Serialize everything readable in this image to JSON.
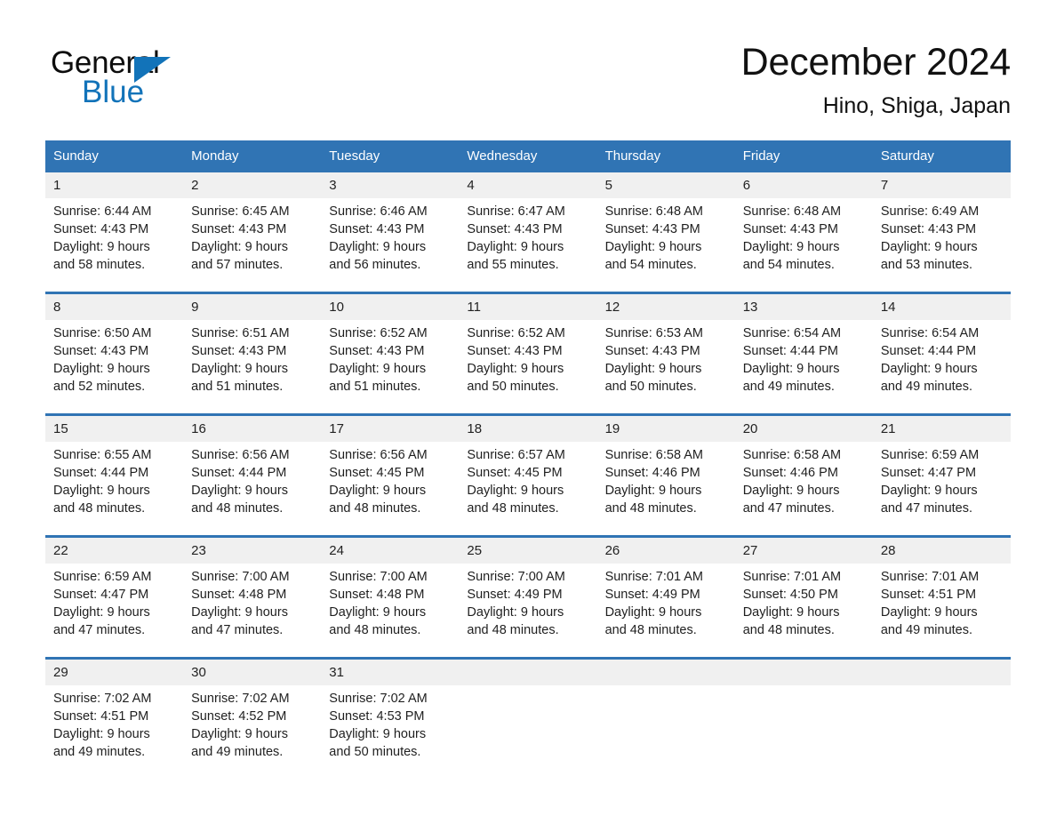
{
  "brand": {
    "name_part1": "General",
    "name_part2": "Blue",
    "triangle_color": "#1273b9"
  },
  "header": {
    "title": "December 2024",
    "location": "Hino, Shiga, Japan"
  },
  "colors": {
    "header_blue": "#3074b4",
    "row_band_gray": "#f0f0f0",
    "brand_blue": "#1273b9"
  },
  "calendar": {
    "weekday_headers": [
      "Sunday",
      "Monday",
      "Tuesday",
      "Wednesday",
      "Thursday",
      "Friday",
      "Saturday"
    ],
    "weeks": [
      [
        {
          "day": "1",
          "sunrise": "Sunrise: 6:44 AM",
          "sunset": "Sunset: 4:43 PM",
          "daylight_line1": "Daylight: 9 hours",
          "daylight_line2": "and 58 minutes."
        },
        {
          "day": "2",
          "sunrise": "Sunrise: 6:45 AM",
          "sunset": "Sunset: 4:43 PM",
          "daylight_line1": "Daylight: 9 hours",
          "daylight_line2": "and 57 minutes."
        },
        {
          "day": "3",
          "sunrise": "Sunrise: 6:46 AM",
          "sunset": "Sunset: 4:43 PM",
          "daylight_line1": "Daylight: 9 hours",
          "daylight_line2": "and 56 minutes."
        },
        {
          "day": "4",
          "sunrise": "Sunrise: 6:47 AM",
          "sunset": "Sunset: 4:43 PM",
          "daylight_line1": "Daylight: 9 hours",
          "daylight_line2": "and 55 minutes."
        },
        {
          "day": "5",
          "sunrise": "Sunrise: 6:48 AM",
          "sunset": "Sunset: 4:43 PM",
          "daylight_line1": "Daylight: 9 hours",
          "daylight_line2": "and 54 minutes."
        },
        {
          "day": "6",
          "sunrise": "Sunrise: 6:48 AM",
          "sunset": "Sunset: 4:43 PM",
          "daylight_line1": "Daylight: 9 hours",
          "daylight_line2": "and 54 minutes."
        },
        {
          "day": "7",
          "sunrise": "Sunrise: 6:49 AM",
          "sunset": "Sunset: 4:43 PM",
          "daylight_line1": "Daylight: 9 hours",
          "daylight_line2": "and 53 minutes."
        }
      ],
      [
        {
          "day": "8",
          "sunrise": "Sunrise: 6:50 AM",
          "sunset": "Sunset: 4:43 PM",
          "daylight_line1": "Daylight: 9 hours",
          "daylight_line2": "and 52 minutes."
        },
        {
          "day": "9",
          "sunrise": "Sunrise: 6:51 AM",
          "sunset": "Sunset: 4:43 PM",
          "daylight_line1": "Daylight: 9 hours",
          "daylight_line2": "and 51 minutes."
        },
        {
          "day": "10",
          "sunrise": "Sunrise: 6:52 AM",
          "sunset": "Sunset: 4:43 PM",
          "daylight_line1": "Daylight: 9 hours",
          "daylight_line2": "and 51 minutes."
        },
        {
          "day": "11",
          "sunrise": "Sunrise: 6:52 AM",
          "sunset": "Sunset: 4:43 PM",
          "daylight_line1": "Daylight: 9 hours",
          "daylight_line2": "and 50 minutes."
        },
        {
          "day": "12",
          "sunrise": "Sunrise: 6:53 AM",
          "sunset": "Sunset: 4:43 PM",
          "daylight_line1": "Daylight: 9 hours",
          "daylight_line2": "and 50 minutes."
        },
        {
          "day": "13",
          "sunrise": "Sunrise: 6:54 AM",
          "sunset": "Sunset: 4:44 PM",
          "daylight_line1": "Daylight: 9 hours",
          "daylight_line2": "and 49 minutes."
        },
        {
          "day": "14",
          "sunrise": "Sunrise: 6:54 AM",
          "sunset": "Sunset: 4:44 PM",
          "daylight_line1": "Daylight: 9 hours",
          "daylight_line2": "and 49 minutes."
        }
      ],
      [
        {
          "day": "15",
          "sunrise": "Sunrise: 6:55 AM",
          "sunset": "Sunset: 4:44 PM",
          "daylight_line1": "Daylight: 9 hours",
          "daylight_line2": "and 48 minutes."
        },
        {
          "day": "16",
          "sunrise": "Sunrise: 6:56 AM",
          "sunset": "Sunset: 4:44 PM",
          "daylight_line1": "Daylight: 9 hours",
          "daylight_line2": "and 48 minutes."
        },
        {
          "day": "17",
          "sunrise": "Sunrise: 6:56 AM",
          "sunset": "Sunset: 4:45 PM",
          "daylight_line1": "Daylight: 9 hours",
          "daylight_line2": "and 48 minutes."
        },
        {
          "day": "18",
          "sunrise": "Sunrise: 6:57 AM",
          "sunset": "Sunset: 4:45 PM",
          "daylight_line1": "Daylight: 9 hours",
          "daylight_line2": "and 48 minutes."
        },
        {
          "day": "19",
          "sunrise": "Sunrise: 6:58 AM",
          "sunset": "Sunset: 4:46 PM",
          "daylight_line1": "Daylight: 9 hours",
          "daylight_line2": "and 48 minutes."
        },
        {
          "day": "20",
          "sunrise": "Sunrise: 6:58 AM",
          "sunset": "Sunset: 4:46 PM",
          "daylight_line1": "Daylight: 9 hours",
          "daylight_line2": "and 47 minutes."
        },
        {
          "day": "21",
          "sunrise": "Sunrise: 6:59 AM",
          "sunset": "Sunset: 4:47 PM",
          "daylight_line1": "Daylight: 9 hours",
          "daylight_line2": "and 47 minutes."
        }
      ],
      [
        {
          "day": "22",
          "sunrise": "Sunrise: 6:59 AM",
          "sunset": "Sunset: 4:47 PM",
          "daylight_line1": "Daylight: 9 hours",
          "daylight_line2": "and 47 minutes."
        },
        {
          "day": "23",
          "sunrise": "Sunrise: 7:00 AM",
          "sunset": "Sunset: 4:48 PM",
          "daylight_line1": "Daylight: 9 hours",
          "daylight_line2": "and 47 minutes."
        },
        {
          "day": "24",
          "sunrise": "Sunrise: 7:00 AM",
          "sunset": "Sunset: 4:48 PM",
          "daylight_line1": "Daylight: 9 hours",
          "daylight_line2": "and 48 minutes."
        },
        {
          "day": "25",
          "sunrise": "Sunrise: 7:00 AM",
          "sunset": "Sunset: 4:49 PM",
          "daylight_line1": "Daylight: 9 hours",
          "daylight_line2": "and 48 minutes."
        },
        {
          "day": "26",
          "sunrise": "Sunrise: 7:01 AM",
          "sunset": "Sunset: 4:49 PM",
          "daylight_line1": "Daylight: 9 hours",
          "daylight_line2": "and 48 minutes."
        },
        {
          "day": "27",
          "sunrise": "Sunrise: 7:01 AM",
          "sunset": "Sunset: 4:50 PM",
          "daylight_line1": "Daylight: 9 hours",
          "daylight_line2": "and 48 minutes."
        },
        {
          "day": "28",
          "sunrise": "Sunrise: 7:01 AM",
          "sunset": "Sunset: 4:51 PM",
          "daylight_line1": "Daylight: 9 hours",
          "daylight_line2": "and 49 minutes."
        }
      ],
      [
        {
          "day": "29",
          "sunrise": "Sunrise: 7:02 AM",
          "sunset": "Sunset: 4:51 PM",
          "daylight_line1": "Daylight: 9 hours",
          "daylight_line2": "and 49 minutes."
        },
        {
          "day": "30",
          "sunrise": "Sunrise: 7:02 AM",
          "sunset": "Sunset: 4:52 PM",
          "daylight_line1": "Daylight: 9 hours",
          "daylight_line2": "and 49 minutes."
        },
        {
          "day": "31",
          "sunrise": "Sunrise: 7:02 AM",
          "sunset": "Sunset: 4:53 PM",
          "daylight_line1": "Daylight: 9 hours",
          "daylight_line2": "and 50 minutes."
        },
        {
          "day": "",
          "sunrise": "",
          "sunset": "",
          "daylight_line1": "",
          "daylight_line2": ""
        },
        {
          "day": "",
          "sunrise": "",
          "sunset": "",
          "daylight_line1": "",
          "daylight_line2": ""
        },
        {
          "day": "",
          "sunrise": "",
          "sunset": "",
          "daylight_line1": "",
          "daylight_line2": ""
        },
        {
          "day": "",
          "sunrise": "",
          "sunset": "",
          "daylight_line1": "",
          "daylight_line2": ""
        }
      ]
    ]
  }
}
